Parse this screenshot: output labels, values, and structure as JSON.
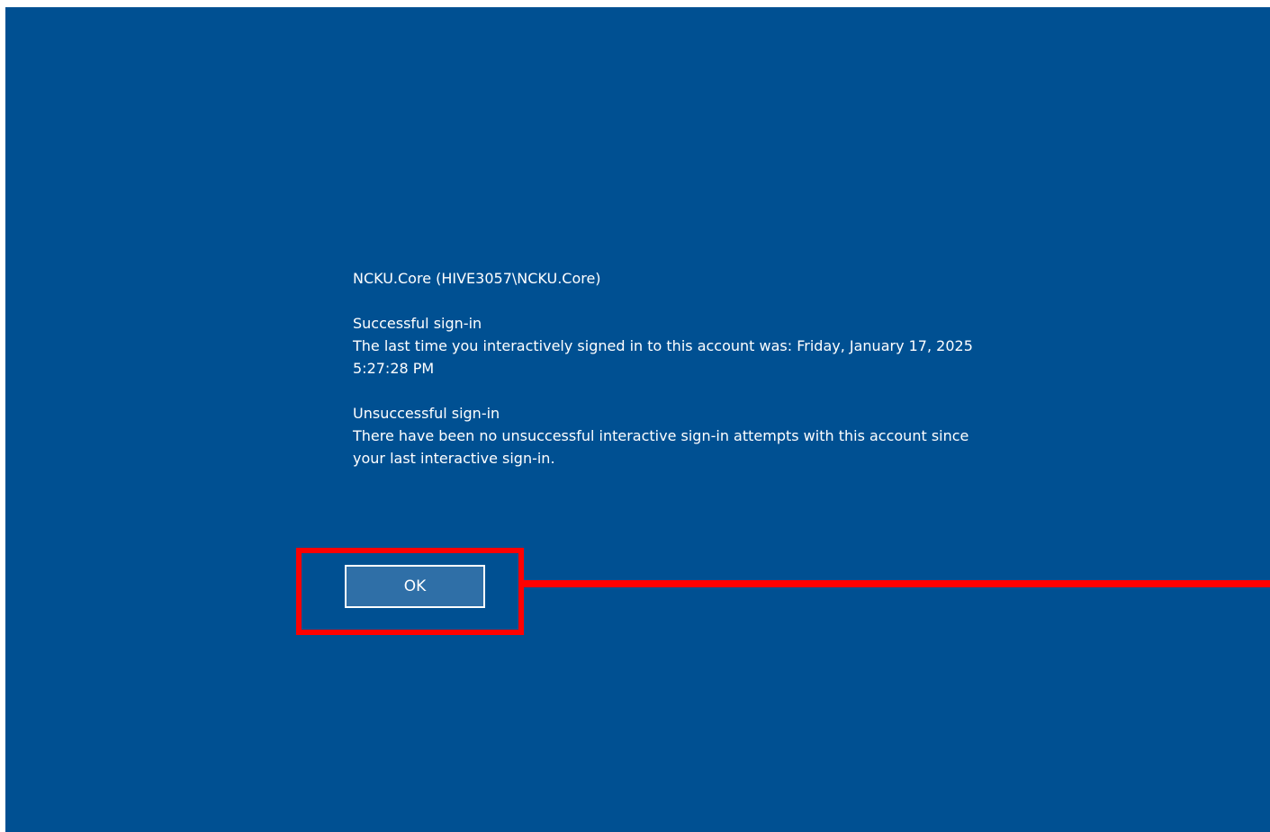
{
  "dialog": {
    "account_line": "NCKU.Core (HIVE3057\\NCKU.Core)",
    "successful": {
      "heading": "Successful sign-in",
      "line1": "The last time you interactively signed in to this account was: Friday, January 17, 2025",
      "line2": "5:27:28 PM"
    },
    "unsuccessful": {
      "heading": "Unsuccessful sign-in",
      "line1": "There have been no unsuccessful interactive sign-in attempts with this account since",
      "line2": "your last interactive sign-in."
    },
    "ok_label": "OK"
  },
  "colors": {
    "background": "#005092",
    "button": "#2f6fa7",
    "highlight": "#ff0000",
    "text": "#ffffff"
  }
}
